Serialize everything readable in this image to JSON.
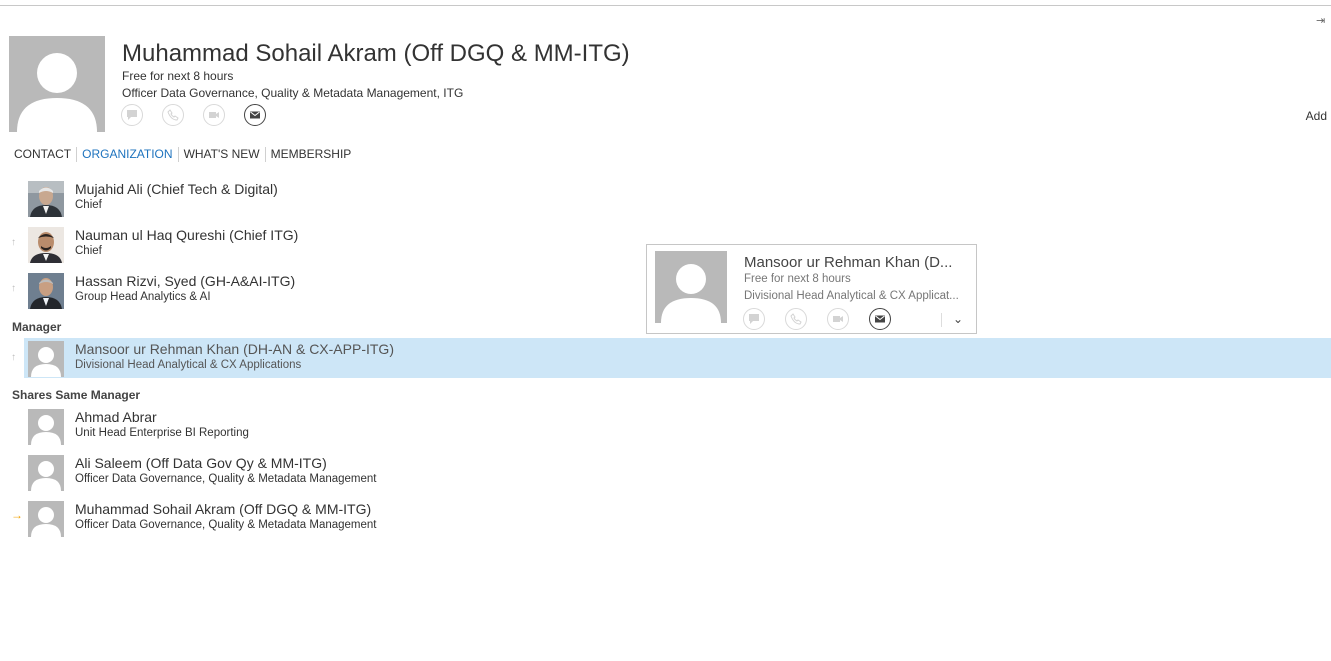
{
  "contact": {
    "name": "Muhammad Sohail Akram (Off DGQ & MM-ITG)",
    "status": "Free for next 8 hours",
    "title": "Officer Data Governance, Quality & Metadata Management, ITG",
    "add_label": "Add"
  },
  "tabs": [
    {
      "label": "CONTACT",
      "active": false
    },
    {
      "label": "ORGANIZATION",
      "active": true
    },
    {
      "label": "WHAT'S NEW",
      "active": false
    },
    {
      "label": "MEMBERSHIP",
      "active": false
    }
  ],
  "organization": {
    "chain": [
      {
        "name": "Mujahid Ali (Chief Tech & Digital)",
        "title": "Chief"
      },
      {
        "name": "Nauman ul Haq Qureshi (Chief ITG)",
        "title": "Chief"
      },
      {
        "name": "Hassan Rizvi, Syed (GH-A&AI-ITG)",
        "title": "Group Head Analytics & AI"
      }
    ],
    "manager_label": "Manager",
    "manager": {
      "name": "Mansoor ur Rehman Khan (DH-AN & CX-APP-ITG)",
      "title": "Divisional Head Analytical & CX Applications"
    },
    "peers_label": "Shares Same Manager",
    "peers": [
      {
        "name": "Ahmad Abrar",
        "title": "Unit Head Enterprise BI Reporting"
      },
      {
        "name": "Ali Saleem (Off Data Gov Qy & MM-ITG)",
        "title": "Officer Data Governance, Quality & Metadata Management"
      },
      {
        "name": "Muhammad Sohail Akram (Off DGQ & MM-ITG)",
        "title": "Officer Data Governance, Quality & Metadata Management"
      }
    ]
  },
  "hover_card": {
    "name": "Mansoor ur Rehman Khan (D...",
    "status": "Free for next 8 hours",
    "title": "Divisional Head Analytical & CX Applicat..."
  }
}
